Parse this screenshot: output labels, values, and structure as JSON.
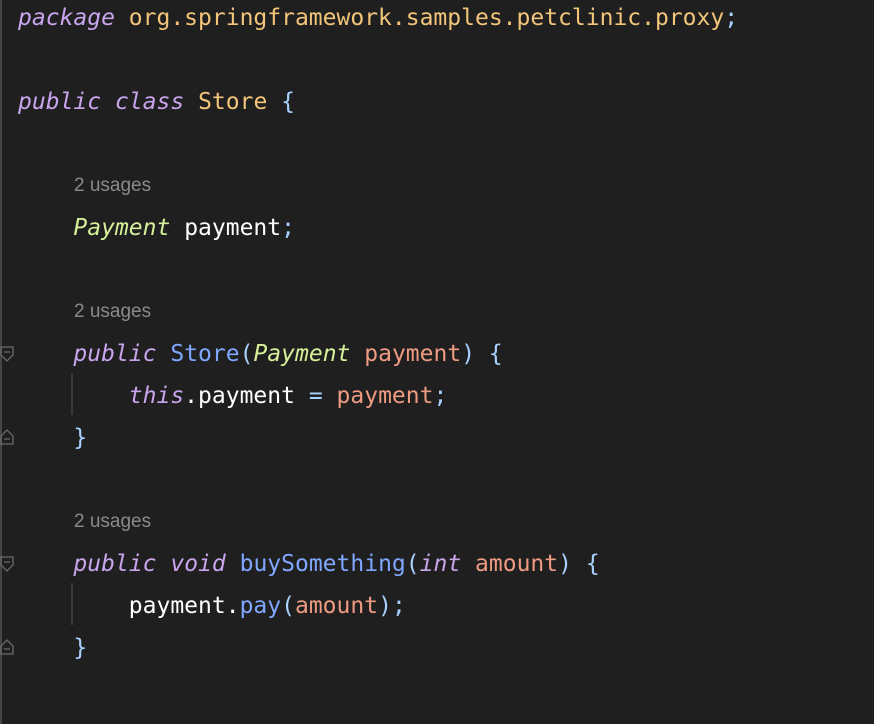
{
  "code": {
    "line1": {
      "kw": "package",
      "pkg": "org.springframework.samples.petclinic.proxy",
      "semi": ";"
    },
    "line2": {
      "kw1": "public",
      "kw2": "class",
      "cls": "Store",
      "brace": "{"
    },
    "inlay1": "2 usages",
    "line3": {
      "type": "Payment",
      "field": "payment",
      "semi": ";"
    },
    "inlay2": "2 usages",
    "line4": {
      "kw": "public",
      "ctor": "Store",
      "open": "(",
      "type": "Payment",
      "param": "payment",
      "close": ")",
      "brace": "{"
    },
    "line5": {
      "kw": "this",
      "dot": ".",
      "field": "payment",
      "eq": "=",
      "param": "payment",
      "semi": ";"
    },
    "line6": {
      "brace": "}"
    },
    "inlay3": "2 usages",
    "line7": {
      "kw1": "public",
      "kw2": "void",
      "method": "buySomething",
      "open": "(",
      "kw3": "int",
      "param": "amount",
      "close": ")",
      "brace": "{"
    },
    "line8": {
      "obj": "payment",
      "dot": ".",
      "method": "pay",
      "open": "(",
      "arg": "amount",
      "close": ")",
      "semi": ";"
    },
    "line9": {
      "brace": "}"
    }
  },
  "colors": {
    "background": "#1f1f1f",
    "keyword": "#c9a5ee",
    "class_name": "#f2c57a",
    "type": "#d6f09a",
    "function": "#7fa7ff",
    "parameter": "#ef9b82",
    "punctuation": "#a9d1ff",
    "inlay_hint": "#8a8a8a"
  },
  "icons": [
    "fold-open-icon",
    "fold-close-icon"
  ]
}
